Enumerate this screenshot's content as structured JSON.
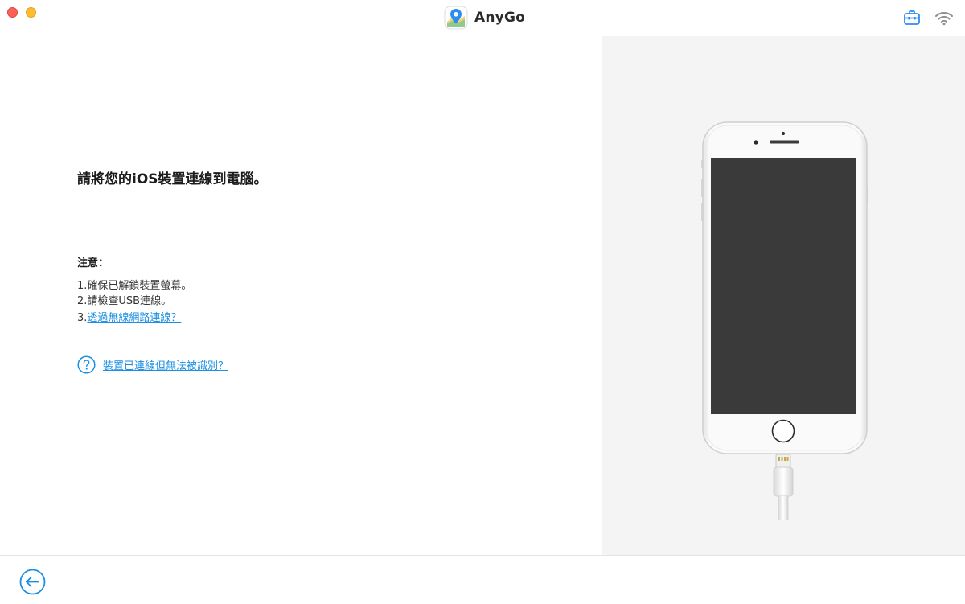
{
  "window": {
    "title": "AnyGo"
  },
  "titlebar": {
    "controls": [
      "close",
      "minimize"
    ],
    "right_icons": [
      "toolbox-icon",
      "wifi-icon"
    ]
  },
  "main": {
    "heading": "請將您的iOS裝置連線到電腦。",
    "note_title": "注意：",
    "notes": [
      "1.確保已解鎖裝置螢幕。",
      "2.請檢查USB連線。"
    ],
    "note3_prefix": "3.",
    "note3_link": "透過無線網路連線？",
    "help_link": "裝置已連線但無法被識別？"
  },
  "illustration": {
    "icon": "iphone-with-lightning-cable",
    "screen_color": "#3a3a3a"
  },
  "footer": {
    "back_icon": "back-arrow-icon"
  },
  "colors": {
    "accent": "#1a8fe3",
    "close": "#fe5f57",
    "minimize": "#febc2e",
    "right_panel_bg": "#f4f4f4"
  }
}
